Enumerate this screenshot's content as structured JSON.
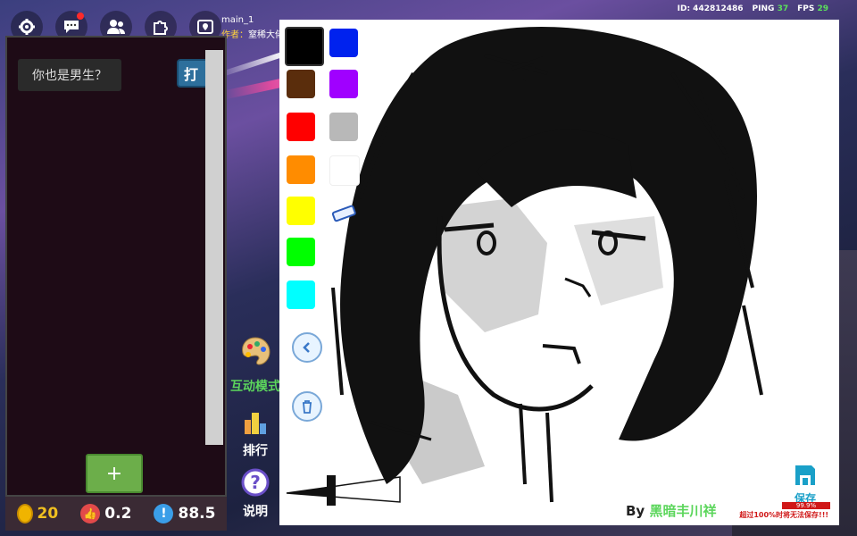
{
  "topbar": {
    "map_name": "main_1",
    "author_label": "作者：",
    "author_name": "窒稀大佬",
    "id_text": "ID: 442812486",
    "ping_label": "PING",
    "ping_value": "37",
    "fps_label": "FPS",
    "fps_value": "29",
    "icons": [
      "gear-icon",
      "chat-icon",
      "friends-icon",
      "puzzle-icon",
      "map-pin-icon"
    ]
  },
  "chat": {
    "message": "你也是男生？",
    "side_button_label": "打",
    "add_label": "+"
  },
  "bottom_stats": {
    "coins": "20",
    "likes": "0.2",
    "info": "88.5"
  },
  "side_menu": {
    "interactive_mode": "互动模式",
    "ranking": "排行",
    "help": "说明"
  },
  "canvas": {
    "colors": [
      "#000000",
      "#0022ee",
      "#5a2d0c",
      "#a000ff",
      "#ff0000",
      "#b8b8b8",
      "#ff8c00",
      "#ffffff",
      "#ffff00",
      "#00ff00",
      "#00ffff"
    ],
    "by_label": "By",
    "artist": "黑暗丰川祥",
    "save_label": "保存",
    "progress_text": "99.9%",
    "warning": "超过100%时将无法保存!!!"
  }
}
